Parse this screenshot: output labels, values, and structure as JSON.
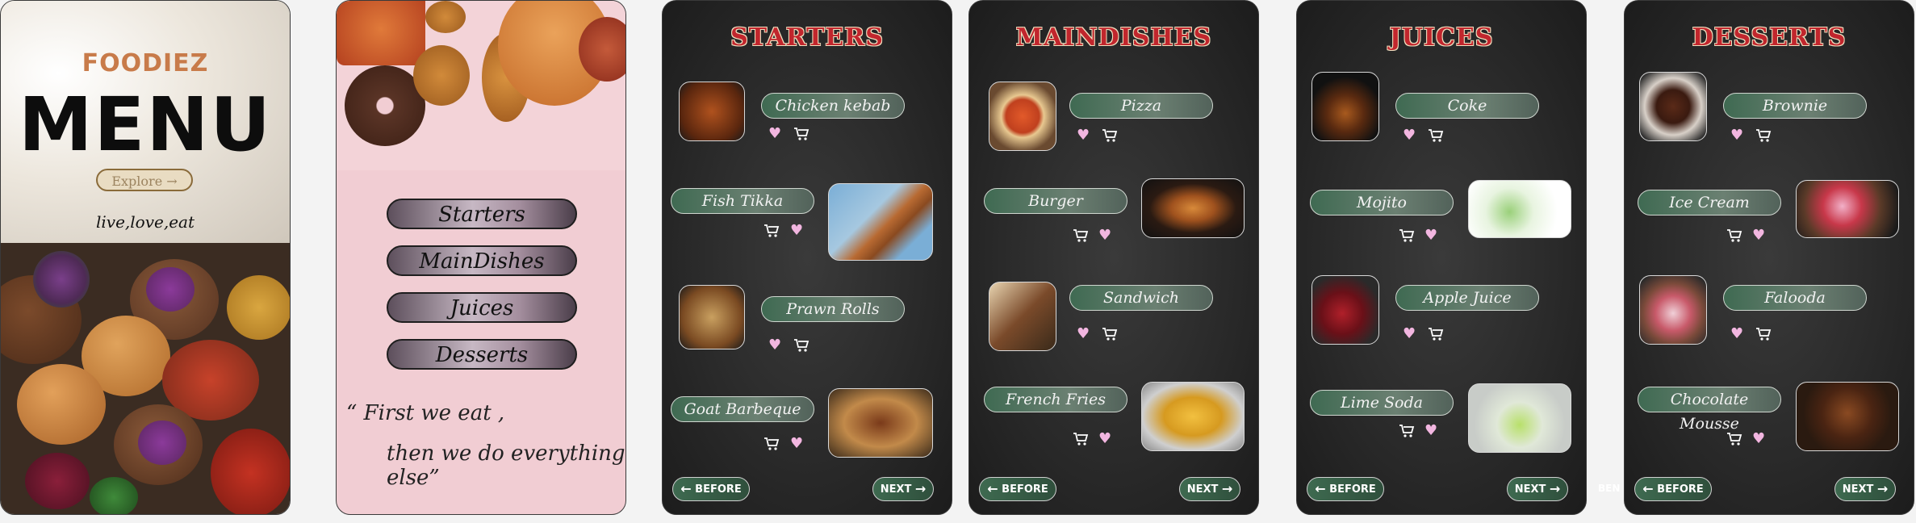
{
  "intro": {
    "brand": "FOODIEZ",
    "title": "MENU",
    "explore_label": "Explore →",
    "tagline": "live,love,eat"
  },
  "categories": {
    "buttons": [
      "Starters",
      "MainDishes",
      "Juices",
      "Desserts"
    ],
    "quote_line1": "“ First we eat ,",
    "quote_line2": "then we do everything else”"
  },
  "nav": {
    "before_label": "BEFORE",
    "next_label": "NEXT",
    "ghost": "BEN"
  },
  "starters": {
    "title": "STARTERS",
    "items": [
      "Chicken kebab",
      "Fish Tikka",
      "Prawn Rolls",
      "Goat Barbeque"
    ]
  },
  "maindishes": {
    "title": "MAINDISHES",
    "items": [
      "Pizza",
      "Burger",
      "Sandwich",
      "French Fries"
    ]
  },
  "juices": {
    "title": "JUICES",
    "items": [
      "Coke",
      "Mojito",
      "Apple Juice",
      "Lime Soda"
    ]
  },
  "desserts": {
    "title": "DESSERTS",
    "items": [
      "Brownie",
      "Ice Cream",
      "Falooda",
      "Chocolate Mousse"
    ]
  },
  "colors": {
    "title_red": "#c1262d",
    "pill_green": "#3f6a52",
    "heart_pink": "#f2b6e0",
    "brand_orange": "#c87b4a"
  }
}
